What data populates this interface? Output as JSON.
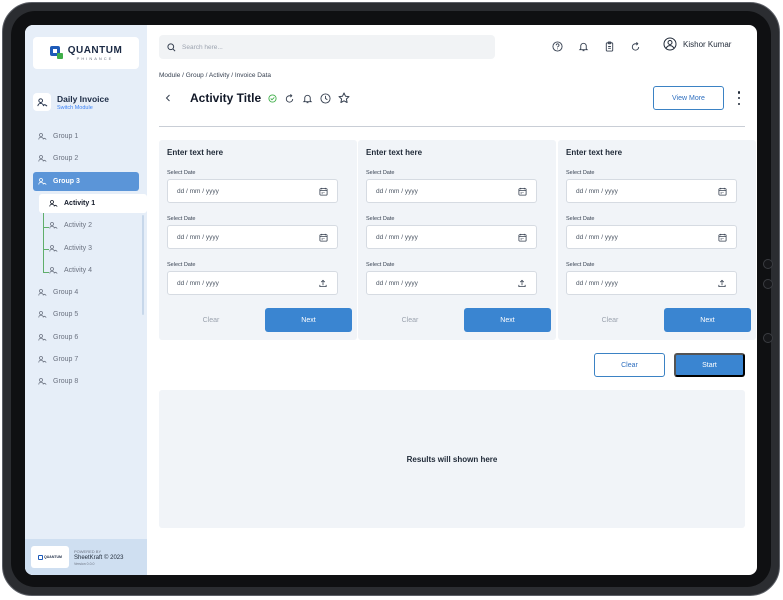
{
  "brand": {
    "name": "QUANTUM",
    "tagline": "PHINANCE",
    "accent": "#1e5bb8",
    "accent2": "#3fae49"
  },
  "module": {
    "title": "Daily Invoice",
    "subtitle": "Switch Module"
  },
  "sidebar": {
    "items": [
      {
        "label": "Group 1"
      },
      {
        "label": "Group 2"
      },
      {
        "label": "Group 3",
        "active": true
      },
      {
        "label": "Activity 1",
        "sub": true,
        "current": true
      },
      {
        "label": "Activity 2",
        "sub": true
      },
      {
        "label": "Activity 3",
        "sub": true
      },
      {
        "label": "Activity 4",
        "sub": true
      },
      {
        "label": "Group 4"
      },
      {
        "label": "Group 5"
      },
      {
        "label": "Group 6"
      },
      {
        "label": "Group 7"
      },
      {
        "label": "Group 8"
      }
    ]
  },
  "footer": {
    "powered": "POWERED BY",
    "product": "SheetKraft © 2023",
    "version": "Version 0.0.0",
    "logo_text": "QUANTUM"
  },
  "search": {
    "placeholder": "Search here..."
  },
  "user": {
    "name": "Kishor Kumar"
  },
  "breadcrumb": "Module / Group / Activity / Invoice Data",
  "page": {
    "title": "Activity Title",
    "view_more": "View More"
  },
  "cards": [
    {
      "title": "Enter text here",
      "fields": [
        {
          "label": "Select Date",
          "placeholder": "dd / mm / yyyy",
          "icon": "calendar-icon"
        },
        {
          "label": "Select Date",
          "placeholder": "dd / mm / yyyy",
          "icon": "calendar-icon"
        },
        {
          "label": "Select Date",
          "placeholder": "dd / mm / yyyy",
          "icon": "upload-icon"
        }
      ],
      "clear": "Clear",
      "next": "Next"
    },
    {
      "title": "Enter text here",
      "fields": [
        {
          "label": "Select Date",
          "placeholder": "dd / mm / yyyy",
          "icon": "calendar-icon"
        },
        {
          "label": "Select Date",
          "placeholder": "dd / mm / yyyy",
          "icon": "calendar-icon"
        },
        {
          "label": "Select Date",
          "placeholder": "dd / mm / yyyy",
          "icon": "upload-icon"
        }
      ],
      "clear": "Clear",
      "next": "Next"
    },
    {
      "title": "Enter text here",
      "fields": [
        {
          "label": "Select Date",
          "placeholder": "dd / mm / yyyy",
          "icon": "calendar-icon"
        },
        {
          "label": "Select Date",
          "placeholder": "dd / mm / yyyy",
          "icon": "calendar-icon"
        },
        {
          "label": "Select Date",
          "placeholder": "dd / mm / yyyy",
          "icon": "upload-icon"
        }
      ],
      "clear": "Clear",
      "next": "Next"
    }
  ],
  "actions": {
    "clear": "Clear",
    "start": "Start"
  },
  "results": {
    "text": "Results will shown here"
  },
  "colors": {
    "primary": "#3a85d1",
    "sidebar_bg": "#e6eef8",
    "active_item": "#5b95d8",
    "card_bg": "#f1f4f8"
  }
}
